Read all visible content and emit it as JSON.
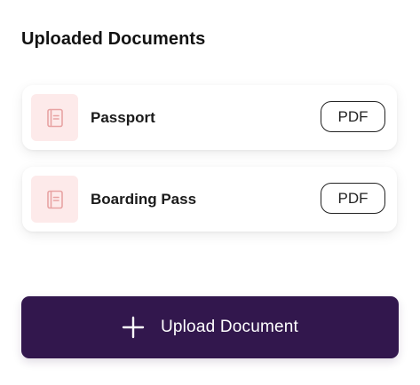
{
  "section": {
    "title": "Uploaded Documents"
  },
  "documents": [
    {
      "name": "Passport",
      "type": "PDF",
      "icon": "document-icon"
    },
    {
      "name": "Boarding Pass",
      "type": "PDF",
      "icon": "document-icon"
    }
  ],
  "upload_button": {
    "label": "Upload Document",
    "icon": "plus-icon"
  },
  "colors": {
    "button_bg": "#32174d",
    "icon_bg": "#fdeaea",
    "icon_stroke": "#e8a3a3"
  }
}
